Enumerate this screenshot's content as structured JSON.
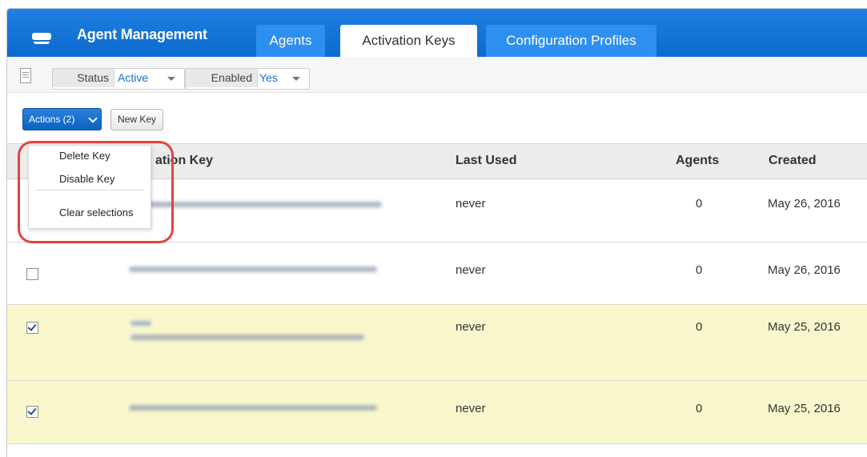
{
  "app": {
    "title": "Agent Management"
  },
  "tabs": [
    {
      "label": "Agents",
      "active": false
    },
    {
      "label": "Activation Keys",
      "active": true
    },
    {
      "label": "Configuration Profiles",
      "active": false
    }
  ],
  "filters": {
    "status": {
      "label": "Status",
      "value": "Active"
    },
    "enabled": {
      "label": "Enabled",
      "value": "Yes"
    }
  },
  "toolbar": {
    "actions_label": "Actions (2)",
    "new_key_label": "New Key"
  },
  "actions_menu": {
    "items": [
      "Delete Key",
      "Disable Key"
    ],
    "clear_label": "Clear selections"
  },
  "table": {
    "columns": [
      "Activation Key",
      "Last Used",
      "Agents",
      "Created"
    ],
    "visible_header_fragment": "ation Key",
    "rows": [
      {
        "checked": false,
        "last_used": "never",
        "agents": "0",
        "created": "May 26, 2016"
      },
      {
        "checked": false,
        "last_used": "never",
        "agents": "0",
        "created": "May 26, 2016"
      },
      {
        "checked": true,
        "last_used": "never",
        "agents": "0",
        "created": "May 25, 2016"
      },
      {
        "checked": true,
        "last_used": "never",
        "agents": "0",
        "created": "May 25, 2016"
      }
    ]
  },
  "colors": {
    "header_blue": "#1576db",
    "selected_row": "#f8f8cc",
    "highlight_ring": "#e0443f",
    "filter_value": "#1a6fc9"
  },
  "icons": [
    "brand-icon",
    "filter-list-icon",
    "chevron-down-icon",
    "caret-down-icon",
    "checkbox-icon"
  ]
}
